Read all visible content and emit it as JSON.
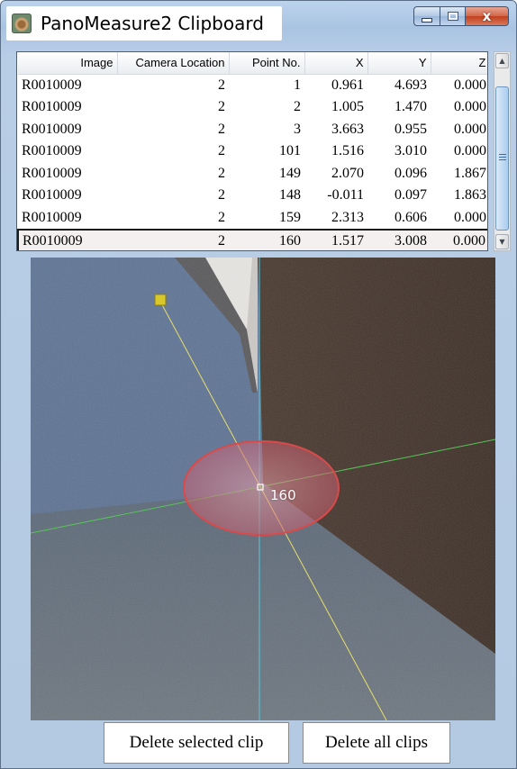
{
  "window": {
    "title": "PanoMeasure2 Clipboard",
    "close_glyph": "x",
    "icons": {
      "app": "camera-app-icon",
      "minimize": "minimize-icon",
      "maximize": "maximize-icon",
      "close": "close-icon"
    }
  },
  "table": {
    "columns": [
      "Image",
      "Camera Location",
      "Point No.",
      "X",
      "Y",
      "Z"
    ],
    "rows": [
      [
        "R0010009",
        "2",
        "1",
        "0.961",
        "4.693",
        "0.000"
      ],
      [
        "R0010009",
        "2",
        "2",
        "1.005",
        "1.470",
        "0.000"
      ],
      [
        "R0010009",
        "2",
        "3",
        "3.663",
        "0.955",
        "0.000"
      ],
      [
        "R0010009",
        "2",
        "101",
        "1.516",
        "3.010",
        "0.000"
      ],
      [
        "R0010009",
        "2",
        "149",
        "2.070",
        "0.096",
        "1.867"
      ],
      [
        "R0010009",
        "2",
        "148",
        "-0.011",
        "0.097",
        "1.863"
      ],
      [
        "R0010009",
        "2",
        "159",
        "2.313",
        "0.606",
        "0.000"
      ],
      [
        "R0010009",
        "2",
        "160",
        "1.517",
        "3.008",
        "0.000"
      ]
    ],
    "selected_row": 7
  },
  "scrollbar": {
    "up_glyph": "▲",
    "down_glyph": "▼"
  },
  "viewer": {
    "point_label": "160",
    "colors": {
      "target_ellipse": "#d94a4a",
      "axis_x": "#58c458",
      "axis_y": "#e8de6a",
      "axis_z": "#55c8d8",
      "handle": "#d8c82a"
    }
  },
  "buttons": {
    "delete_selected": "Delete selected clip",
    "delete_all": "Delete all clips"
  }
}
